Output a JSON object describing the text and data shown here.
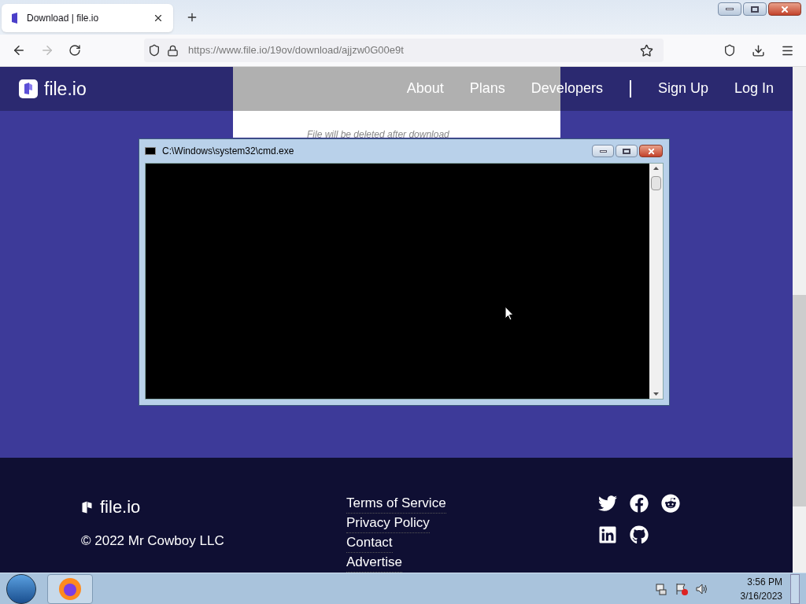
{
  "browser": {
    "tab": {
      "title": "Download | file.io",
      "selected": true
    },
    "url": {
      "host": "https://www.file.io",
      "path": "/19ov/download/ajjzw0G00e9t"
    }
  },
  "site": {
    "logo": "file.io",
    "nav": [
      {
        "label": "About"
      },
      {
        "label": "Plans"
      },
      {
        "label": "Developers"
      }
    ],
    "auth": [
      {
        "label": "Sign Up"
      },
      {
        "label": "Log In"
      }
    ],
    "notice": "File will be deleted after download"
  },
  "console": {
    "title": "C:\\Windows\\system32\\cmd.exe"
  },
  "footer": {
    "logo": "file.io",
    "copyright": "© 2022 Mr Cowboy LLC",
    "links": [
      "Terms of Service",
      "Privacy Policy",
      "Contact",
      "Advertise"
    ]
  },
  "taskbar": {
    "time": "3:56 PM",
    "date": "3/16/2023"
  }
}
